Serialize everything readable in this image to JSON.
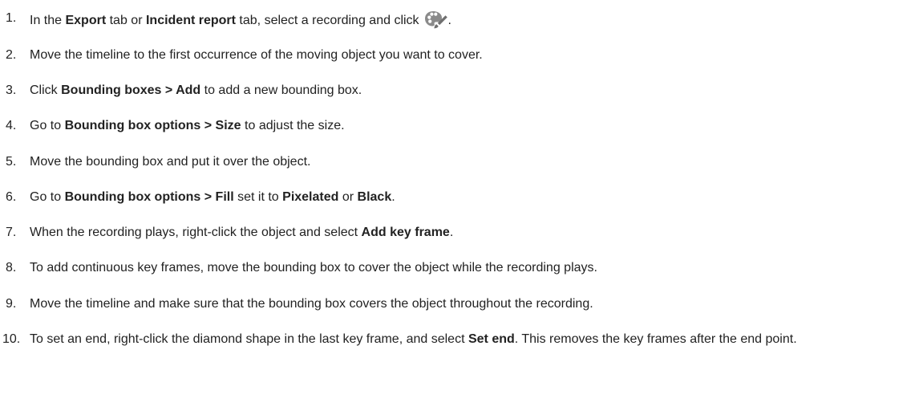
{
  "steps": [
    {
      "number": "1.",
      "parts": [
        "In the ",
        "Export",
        " tab or ",
        "Incident report",
        " tab, select a recording and click",
        "."
      ],
      "icon": "palette-brush-icon"
    },
    {
      "number": "2.",
      "text": "Move the timeline to the first occurrence of the moving object you want to cover."
    },
    {
      "number": "3.",
      "parts": [
        "Click ",
        "Bounding boxes > Add",
        " to add a new bounding box."
      ]
    },
    {
      "number": "4.",
      "parts": [
        "Go to ",
        "Bounding box options > Size",
        " to adjust the size."
      ]
    },
    {
      "number": "5.",
      "text": "Move the bounding box and put it over the object."
    },
    {
      "number": "6.",
      "parts": [
        "Go to ",
        "Bounding box options > Fill",
        " set it to ",
        "Pixelated",
        " or ",
        "Black",
        "."
      ]
    },
    {
      "number": "7.",
      "parts": [
        "When the recording plays, right-click the object and select ",
        "Add key frame",
        "."
      ]
    },
    {
      "number": "8.",
      "text": "To add continuous key frames, move the bounding box to cover the object while the recording plays."
    },
    {
      "number": "9.",
      "text": "Move the timeline and make sure that the bounding box covers the object throughout the recording."
    },
    {
      "number": "10.",
      "parts": [
        "To set an end, right-click the diamond shape in the last key frame, and select ",
        "Set end",
        ". This removes the key frames after the end point."
      ]
    }
  ],
  "colors": {
    "text": "#222222",
    "icon": "#888888"
  }
}
